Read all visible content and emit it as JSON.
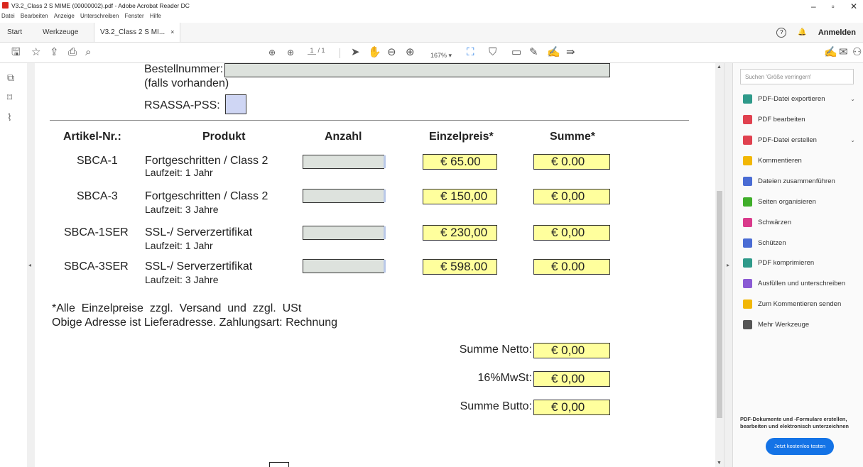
{
  "window": {
    "title": "V3.2_Class 2 S MIME (00000002).pdf - Adobe Acrobat Reader DC",
    "min": "–",
    "max": "▫",
    "close": "✕"
  },
  "menu": [
    "Datei",
    "Bearbeiten",
    "Anzeige",
    "Unterschreiben",
    "Fenster",
    "Hilfe"
  ],
  "tabs": {
    "start": "Start",
    "tools": "Werkzeuge",
    "doc": "V3.2_Class 2 S MI...",
    "close": "×"
  },
  "topright": {
    "help": "?",
    "bell": "🔔",
    "signin": "Anmelden"
  },
  "toolbar": {
    "page_current": "1",
    "page_total": "/ 1",
    "zoom": "167%"
  },
  "doc": {
    "order_label": "Bestellnummer:",
    "order_note": "(falls vorhanden)",
    "rsassa_label": "RSASSA-PSS:",
    "headers": [
      "Artikel-Nr.:",
      "Produkt",
      "Anzahl",
      "Einzelpreis*",
      "Summe*"
    ],
    "rows": [
      {
        "nr": "SBCA-1",
        "product": "Fortgeschritten / Class 2",
        "duration": "Laufzeit: 1 Jahr",
        "price": "€ 65.00",
        "sum": "€ 0.00"
      },
      {
        "nr": "SBCA-3",
        "product": "Fortgeschritten / Class 2",
        "duration": "Laufzeit: 3 Jahre",
        "price": "€ 150,00",
        "sum": "€ 0,00"
      },
      {
        "nr": "SBCA-1SER",
        "product": "SSL-/ Serverzertifikat",
        "duration": "Laufzeit: 1 Jahr",
        "price": "€ 230,00",
        "sum": "€ 0,00"
      },
      {
        "nr": "SBCA-3SER",
        "product": "SSL-/ Serverzertifikat",
        "duration": "Laufzeit: 3 Jahre",
        "price": "€ 598.00",
        "sum": "€ 0.00"
      }
    ],
    "note1": "*Alle  Einzelpreise  zzgl.  Versand  und  zzgl.  USt",
    "note2": "Obige Adresse ist Lieferadresse. Zahlungsart: Rechnung",
    "totals": [
      {
        "label": "Summe Netto:",
        "value": "€ 0,00"
      },
      {
        "label": "16%MwSt:",
        "value": "€ 0,00"
      },
      {
        "label": "Summe Butto:",
        "value": "€ 0,00"
      }
    ]
  },
  "panel": {
    "search_placeholder": "Suchen 'Größe verringern'",
    "tools": [
      {
        "label": "PDF-Datei exportieren",
        "color": "#2f9a8a"
      },
      {
        "label": "PDF bearbeiten",
        "color": "#e0414f"
      },
      {
        "label": "PDF-Datei erstellen",
        "color": "#e0414f"
      },
      {
        "label": "Kommentieren",
        "color": "#f2b705"
      },
      {
        "label": "Dateien zusammenführen",
        "color": "#4a6cd4"
      },
      {
        "label": "Seiten organisieren",
        "color": "#3fae2a"
      },
      {
        "label": "Schwärzen",
        "color": "#d93a8b"
      },
      {
        "label": "Schützen",
        "color": "#4a6cd4"
      },
      {
        "label": "PDF komprimieren",
        "color": "#2f9a8a"
      },
      {
        "label": "Ausfüllen und unterschreiben",
        "color": "#8a5ad4"
      },
      {
        "label": "Zum Kommentieren senden",
        "color": "#f2b705"
      },
      {
        "label": "Mehr Werkzeuge",
        "color": "#555555"
      }
    ],
    "promo": "PDF-Dokumente und -Formulare erstellen, bearbeiten und elektronisch unterzeichnen",
    "try_button": "Jetzt kostenlos testen"
  }
}
